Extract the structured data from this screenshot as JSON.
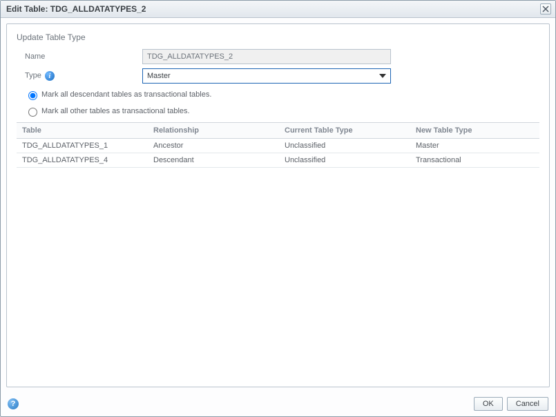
{
  "dialog": {
    "title": "Edit Table: TDG_ALLDATATYPES_2"
  },
  "section": {
    "title": "Update Table Type"
  },
  "form": {
    "name_label": "Name",
    "name_value": "TDG_ALLDATATYPES_2",
    "type_label": "Type",
    "type_value": "Master"
  },
  "radios": {
    "option1": "Mark all descendant tables as transactional tables.",
    "option2": "Mark all other tables as transactional tables."
  },
  "grid": {
    "headers": {
      "table": "Table",
      "relationship": "Relationship",
      "current": "Current Table Type",
      "new": "New Table Type"
    },
    "rows": [
      {
        "table": "TDG_ALLDATATYPES_1",
        "relationship": "Ancestor",
        "current": "Unclassified",
        "new": "Master"
      },
      {
        "table": "TDG_ALLDATATYPES_4",
        "relationship": "Descendant",
        "current": "Unclassified",
        "new": "Transactional"
      }
    ]
  },
  "footer": {
    "ok": "OK",
    "cancel": "Cancel"
  }
}
